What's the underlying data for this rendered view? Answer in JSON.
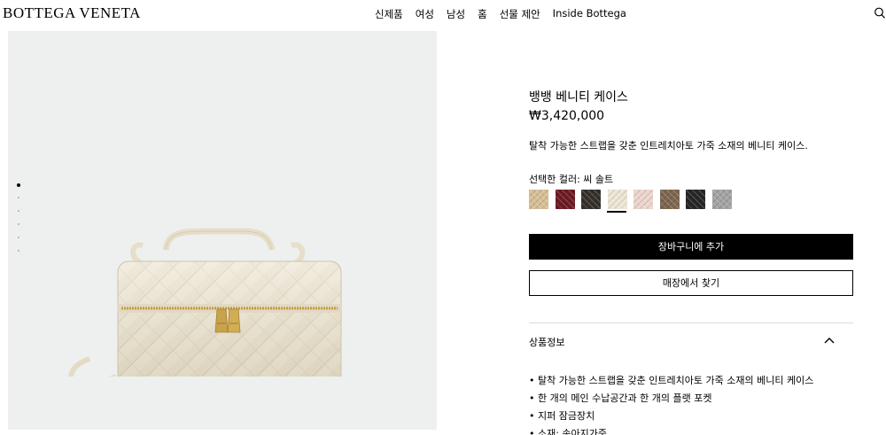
{
  "header": {
    "logo": "BOTTEGA VENETA",
    "nav": [
      "신제품",
      "여성",
      "남성",
      "홈",
      "선물 제안",
      "Inside Bottega"
    ],
    "search_icon": "search-icon"
  },
  "gallery": {
    "slide_count": 6,
    "active_slide": 1
  },
  "product": {
    "title": "뱅뱅 베니티 케이스",
    "price": "₩3,420,000",
    "description": "탈착 가능한 스트랩을 갖춘 인트레치아토 가죽 소재의 베니티 케이스.",
    "color_label": "선택한 컬러: 씨 솔트",
    "swatches": [
      {
        "color": "#d6bf95",
        "selected": false
      },
      {
        "color": "#6e1a22",
        "selected": false
      },
      {
        "color": "#35302a",
        "selected": false
      },
      {
        "color": "#ece6d6",
        "selected": true
      },
      {
        "color": "#ecd5cc",
        "selected": false
      },
      {
        "color": "#7d6650",
        "selected": false
      },
      {
        "color": "#262626",
        "selected": false
      },
      {
        "color": "#a3a3a3",
        "selected": false
      }
    ],
    "add_to_cart": "장바구니에 추가",
    "find_in_store": "매장에서 찾기",
    "details_title": "상품정보",
    "details": [
      "• 탈착 가능한 스트랩을 갖춘 인트레치아토 가죽 소재의 베니티 케이스",
      "• 한 개의 메인 수납공간과 한 개의 플랫 포켓",
      "• 지퍼 잠금장치",
      "• 소재: 송아지가죽"
    ]
  }
}
